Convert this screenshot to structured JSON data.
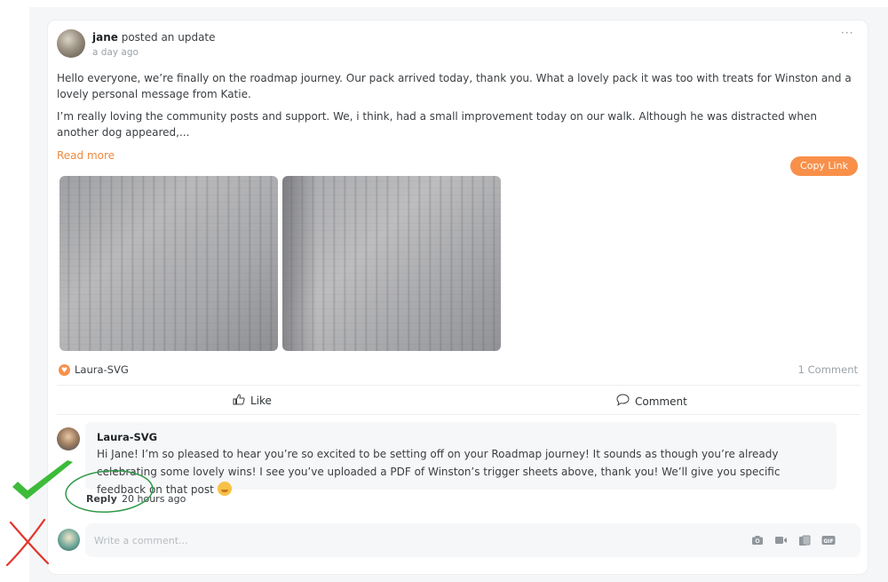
{
  "post": {
    "author": "jane",
    "action": " posted an update",
    "time": "a day ago",
    "more": "···",
    "paragraph1": "Hello everyone, we’re finally on the roadmap journey. Our pack arrived today, thank you. What a lovely pack it was too with treats for Winston and a lovely personal message from Katie.",
    "paragraph2": "I’m really loving the community posts and support. We, i think, had a small improvement today on our walk. Although he was distracted when another dog appeared,...",
    "read_more": "Read more",
    "copy_link": "Copy Link"
  },
  "reactions": {
    "reactor": "Laura-SVG",
    "comment_count": "1 Comment"
  },
  "actions": {
    "like": "Like",
    "comment": "Comment"
  },
  "comment": {
    "author": "Laura-SVG",
    "text": "Hi Jane! I’m so pleased to hear you’re so excited to be setting off on your Roadmap journey! It sounds as though you’re already celebrating some lovely wins! I see you’ve uploaded a PDF of Winston’s trigger sheets above, thank you! We’ll give you specific feedback on that post",
    "reply": "Reply",
    "time": "20 hours ago"
  },
  "composer": {
    "placeholder": "Write a comment..."
  },
  "colors": {
    "accent": "#f8904a",
    "check": "#3dbb3a",
    "cross": "#e2352d",
    "highlight_circle": "#2e9a48"
  }
}
